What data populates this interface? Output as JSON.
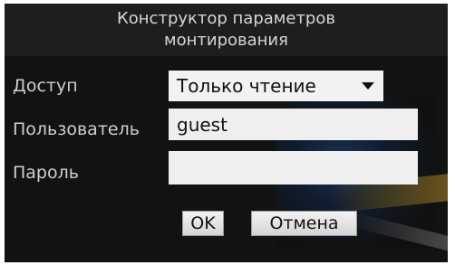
{
  "dialog": {
    "title_line1": "Конструктор параметров",
    "title_line2": "монтирования"
  },
  "form": {
    "access_label": "Доступ",
    "access_value": "Только чтение",
    "user_label": "Пользователь",
    "user_value": "guest",
    "password_label": "Пароль",
    "password_value": ""
  },
  "buttons": {
    "ok_label": "OK",
    "cancel_label": "Отмена"
  },
  "icons": {
    "dropdown": "chevron-down-icon"
  }
}
